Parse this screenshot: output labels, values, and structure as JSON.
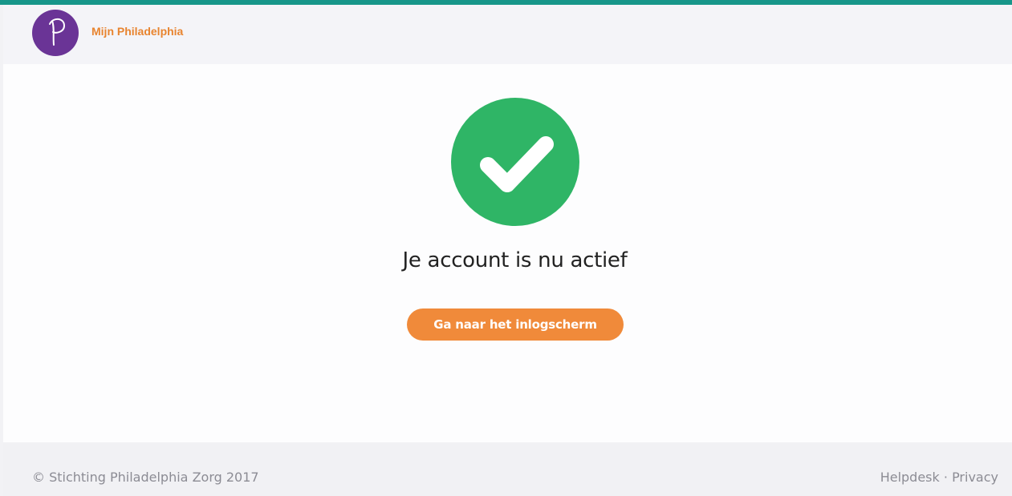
{
  "brand": {
    "logo_icon": "philadelphia-p-logo",
    "name": "Mijn Philadelphia"
  },
  "status": {
    "icon": "checkmark-icon",
    "message": "Je account is nu actief"
  },
  "actions": {
    "login_button_label": "Ga naar het inlogscherm"
  },
  "footer": {
    "copyright": "© Stichting Philadelphia Zorg 2017",
    "links": {
      "helpdesk": "Helpdesk",
      "separator": "·",
      "privacy": "Privacy"
    }
  },
  "colors": {
    "top_bar": "#17968a",
    "logo": "#6a3496",
    "brand_text": "#e8842f",
    "success": "#2fb566",
    "button": "#f08a3a"
  }
}
